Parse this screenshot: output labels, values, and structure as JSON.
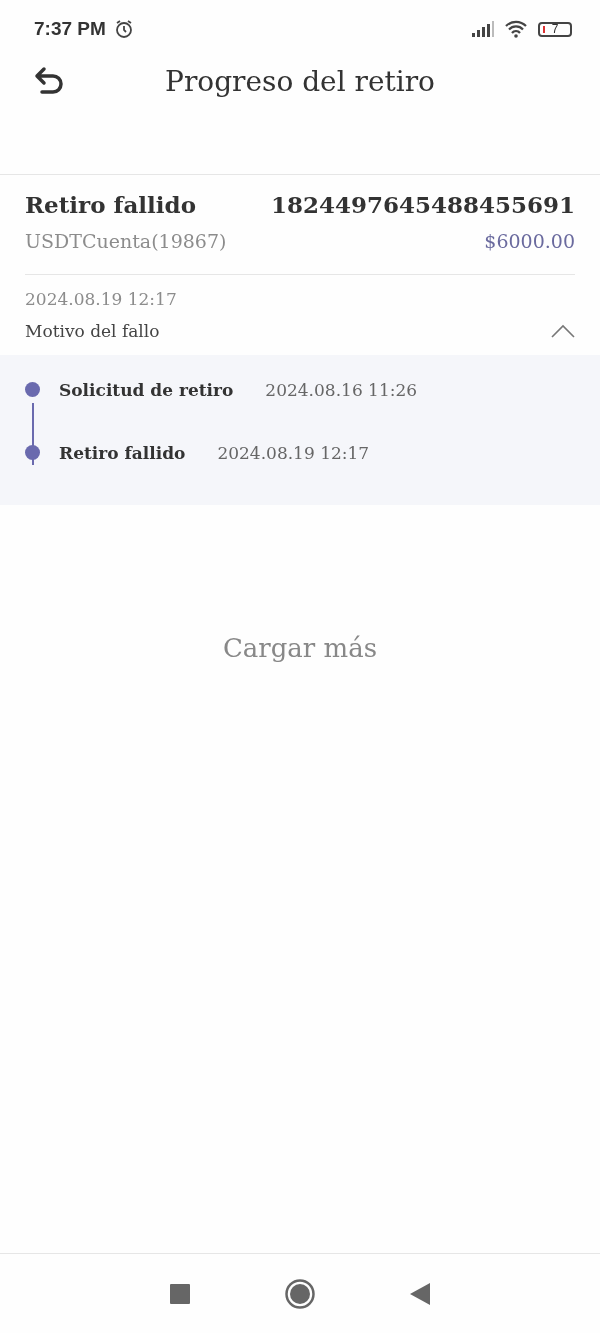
{
  "status_bar": {
    "time": "7:37 PM",
    "battery": "7"
  },
  "header": {
    "title": "Progreso del retiro"
  },
  "withdrawal": {
    "status": "Retiro fallido",
    "order_id": "1824497645488455691",
    "account": "USDTCuenta(19867)",
    "amount": "$6000.00",
    "date": "2024.08.19 12:17",
    "reason_label": "Motivo del fallo",
    "expanded": true
  },
  "timeline": [
    {
      "label": "Solicitud de retiro",
      "time": "2024.08.16 11:26"
    },
    {
      "label": "Retiro fallido",
      "time": "2024.08.19 12:17"
    }
  ],
  "load_more": "Cargar más"
}
